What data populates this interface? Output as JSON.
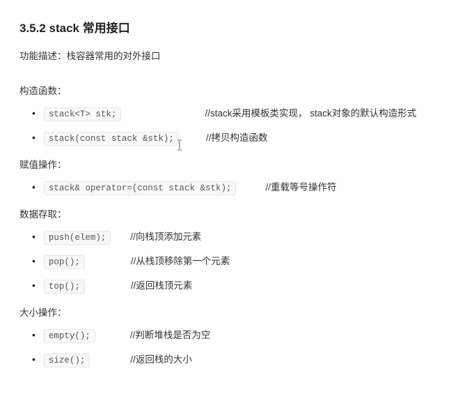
{
  "heading": "3.5.2 stack 常用接口",
  "description": "功能描述：栈容器常用的对外接口",
  "sections": {
    "ctor": {
      "label": "构造函数：",
      "items": [
        {
          "code": "stack<T> stk;",
          "comment": "//stack采用模板类实现， stack对象的默认构造形式"
        },
        {
          "code": "stack(const stack &stk);",
          "comment": "//拷贝构造函数",
          "has_cursor": true
        }
      ]
    },
    "assign": {
      "label": "赋值操作：",
      "items": [
        {
          "code": "stack& operator=(const stack &stk);",
          "comment": "//重载等号操作符"
        }
      ]
    },
    "access": {
      "label": "数据存取：",
      "items": [
        {
          "code": "push(elem);",
          "comment": "//向栈顶添加元素"
        },
        {
          "code": "pop();",
          "comment": "//从栈顶移除第一个元素"
        },
        {
          "code": "top();",
          "comment": "//返回栈顶元素"
        }
      ]
    },
    "size": {
      "label": "大小操作：",
      "items": [
        {
          "code": "empty();",
          "comment": "//判断堆栈是否为空"
        },
        {
          "code": "size();",
          "comment": "//返回栈的大小"
        }
      ]
    }
  }
}
